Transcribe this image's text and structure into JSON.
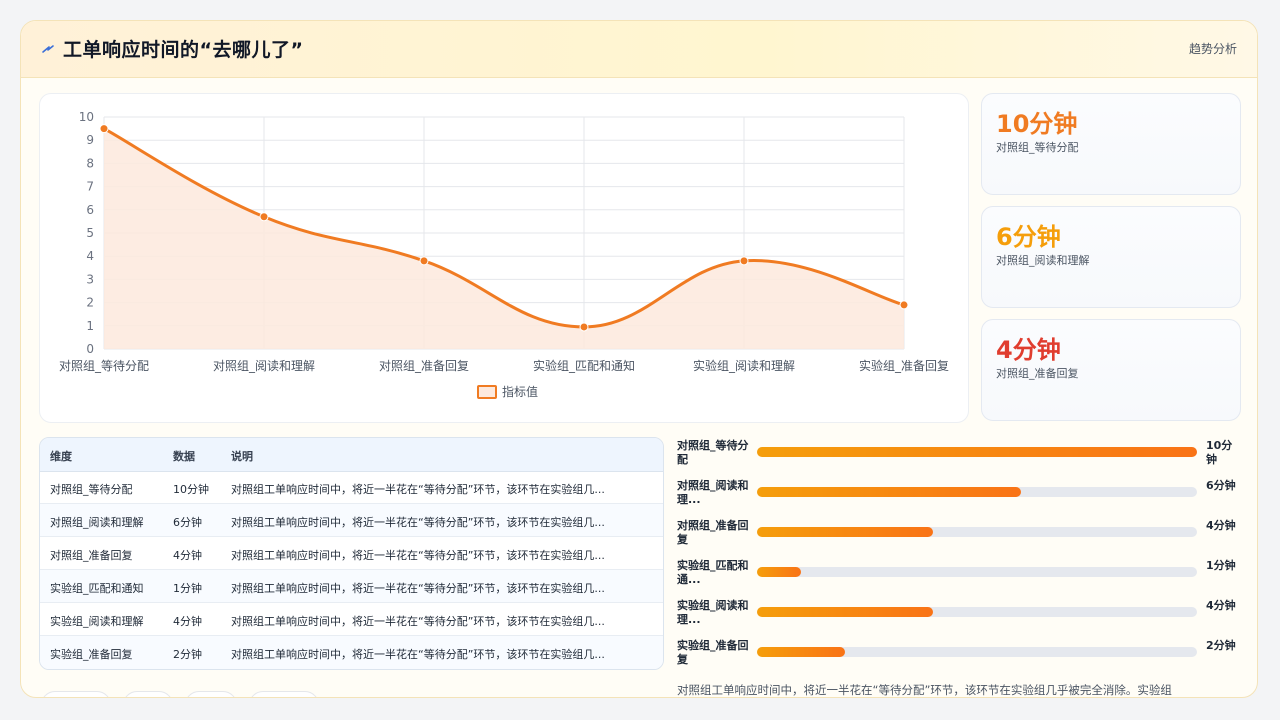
{
  "header": {
    "title": "工单响应时间的“去哪儿了”",
    "action": "趋势分析"
  },
  "chart_data": {
    "type": "line",
    "categories": [
      "对照组_等待分配",
      "对照组_阅读和理解",
      "对照组_准备回复",
      "实验组_匹配和通知",
      "实验组_阅读和理解",
      "实验组_准备回复"
    ],
    "series": [
      {
        "name": "指标值",
        "values": [
          9.5,
          5.7,
          3.8,
          0.95,
          3.8,
          1.9
        ]
      }
    ],
    "yticks": [
      "0",
      "1",
      "2",
      "3",
      "4",
      "5",
      "6",
      "7",
      "8",
      "9",
      "10"
    ],
    "ylim": [
      0,
      10
    ],
    "grid": true,
    "legend": "bottom",
    "colors": {
      "line": "#f07b22",
      "area": "#fde9dd"
    }
  },
  "stats": [
    {
      "value": "10分钟",
      "label": "对照组_等待分配",
      "color": "#f07b22"
    },
    {
      "value": "6分钟",
      "label": "对照组_阅读和理解",
      "color": "#f59e0b"
    },
    {
      "value": "4分钟",
      "label": "对照组_准备回复",
      "color": "#e03d2f"
    }
  ],
  "table": {
    "headers": [
      "维度",
      "数据",
      "说明"
    ],
    "rows": [
      {
        "dim": "对照组_等待分配",
        "val": "10分钟",
        "desc": "对照组工单响应时间中，将近一半花在“等待分配”环节，该环节在实验组几..."
      },
      {
        "dim": "对照组_阅读和理解",
        "val": "6分钟",
        "desc": "对照组工单响应时间中，将近一半花在“等待分配”环节，该环节在实验组几..."
      },
      {
        "dim": "对照组_准备回复",
        "val": "4分钟",
        "desc": "对照组工单响应时间中，将近一半花在“等待分配”环节，该环节在实验组几..."
      },
      {
        "dim": "实验组_匹配和通知",
        "val": "1分钟",
        "desc": "对照组工单响应时间中，将近一半花在“等待分配”环节，该环节在实验组几..."
      },
      {
        "dim": "实验组_阅读和理解",
        "val": "4分钟",
        "desc": "对照组工单响应时间中，将近一半花在“等待分配”环节，该环节在实验组几..."
      },
      {
        "dim": "实验组_准备回复",
        "val": "2分钟",
        "desc": "对照组工单响应时间中，将近一半花在“等待分配”环节，该环节在实验组几..."
      }
    ]
  },
  "bars": {
    "max": 10,
    "items": [
      {
        "label": "对照组_等待分配",
        "value": 10,
        "display": "10分钟"
      },
      {
        "label": "对照组_阅读和理...",
        "value": 6,
        "display": "6分钟"
      },
      {
        "label": "对照组_准备回复",
        "value": 4,
        "display": "4分钟"
      },
      {
        "label": "实验组_匹配和通...",
        "value": 1,
        "display": "1分钟"
      },
      {
        "label": "实验组_阅读和理...",
        "value": 4,
        "display": "4分钟"
      },
      {
        "label": "实验组_准备回复",
        "value": 2,
        "display": "2分钟"
      }
    ]
  },
  "summary": "对照组工单响应时间中，将近一半花在“等待分配”环节，该环节在实验组几乎被完全消除。实验组"
}
